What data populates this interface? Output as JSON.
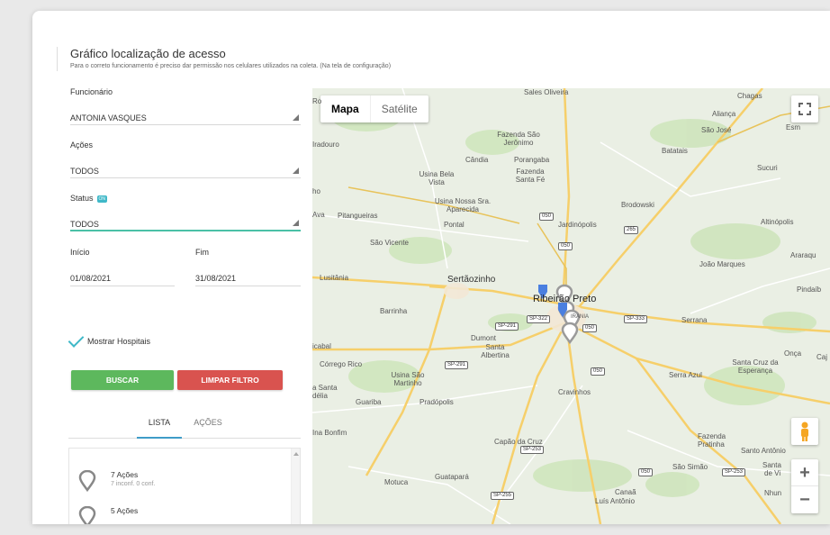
{
  "header": {
    "title": "Gráfico localização de acesso",
    "subtitle": "Para o correto funcionamento é preciso dar permissão nos celulares utilizados na coleta. (Na tela de configuração)"
  },
  "filters": {
    "funcionario_label": "Funcionário",
    "funcionario_value": "ANTONIA VASQUES",
    "acoes_label": "Ações",
    "acoes_value": "TODOS",
    "status_label": "Status",
    "status_badge": "ON",
    "status_value": "TODOS",
    "inicio_label": "Início",
    "inicio_value": "01/08/2021",
    "fim_label": "Fim",
    "fim_value": "31/08/2021",
    "mostrar_hospitais": "Mostrar Hospitais",
    "mostrar_hospitais_checked": true,
    "buscar_label": "BUSCAR",
    "limpar_label": "LIMPAR FILTRO"
  },
  "tabs": [
    {
      "label": "LISTA",
      "active": true
    },
    {
      "label": "AÇÕES",
      "active": false
    }
  ],
  "list": [
    {
      "title": "7 Ações",
      "detail": "7 inconf. 0 conf."
    },
    {
      "title": "5 Ações",
      "detail": ""
    }
  ],
  "map": {
    "type_map": "Mapa",
    "type_satellite": "Satélite",
    "labels": [
      "Sales Oliveira",
      "Chagas",
      "Aliança",
      "São José",
      "Esm",
      "Fazenda São Jerônimo",
      "Cândia",
      "Porangaba",
      "Batatais",
      "Sucuri",
      "Iradouro",
      "Usina Bela Vista",
      "Fazenda Santa Fé",
      "Usina Nossa Sra. Aparecida",
      "Brodowski",
      "Pitangueiras",
      "Pontal",
      "Jardinópolis",
      "Altinópolis",
      "São Vicente",
      "João Marques",
      "Araraqu",
      "Lusitânia",
      "Sertãozinho",
      "Ribeirão Preto",
      "Pindaíb",
      "Barrinha",
      "Serrana",
      "Dumont",
      "Santa Albertina",
      "Onça",
      "Caj",
      "Santa Cruz da Esperança",
      "Córrego Rico",
      "Usina São Martinho",
      "Serra Azul",
      "Cravinhos",
      "Guariba",
      "Pradópolis",
      "Ina Bonfim",
      "Capão da Cruz",
      "Fazenda Pratinha",
      "Santo Antônio",
      "São Simão",
      "Santa",
      "de Vi",
      "Nhun",
      "Motuca",
      "Guatapará",
      "Canaã",
      "Luís Antônio",
      "Ro",
      "ho",
      "Ava",
      "icabal",
      "a Santa",
      "délia",
      "IRANIA"
    ],
    "shields": [
      "050",
      "050",
      "265",
      "SP-322",
      "SP-291",
      "SP-333",
      "050",
      "SP-291",
      "050",
      "SP-253",
      "050",
      "SP-253",
      "SP-255"
    ],
    "colors": {
      "road_major": "#f6cf6a",
      "road_minor": "#ffffff",
      "land": "#eaefe4",
      "park": "#cfe5bd",
      "pin": "#9a9a9a",
      "pin_blue": "#4a7fe0"
    }
  }
}
